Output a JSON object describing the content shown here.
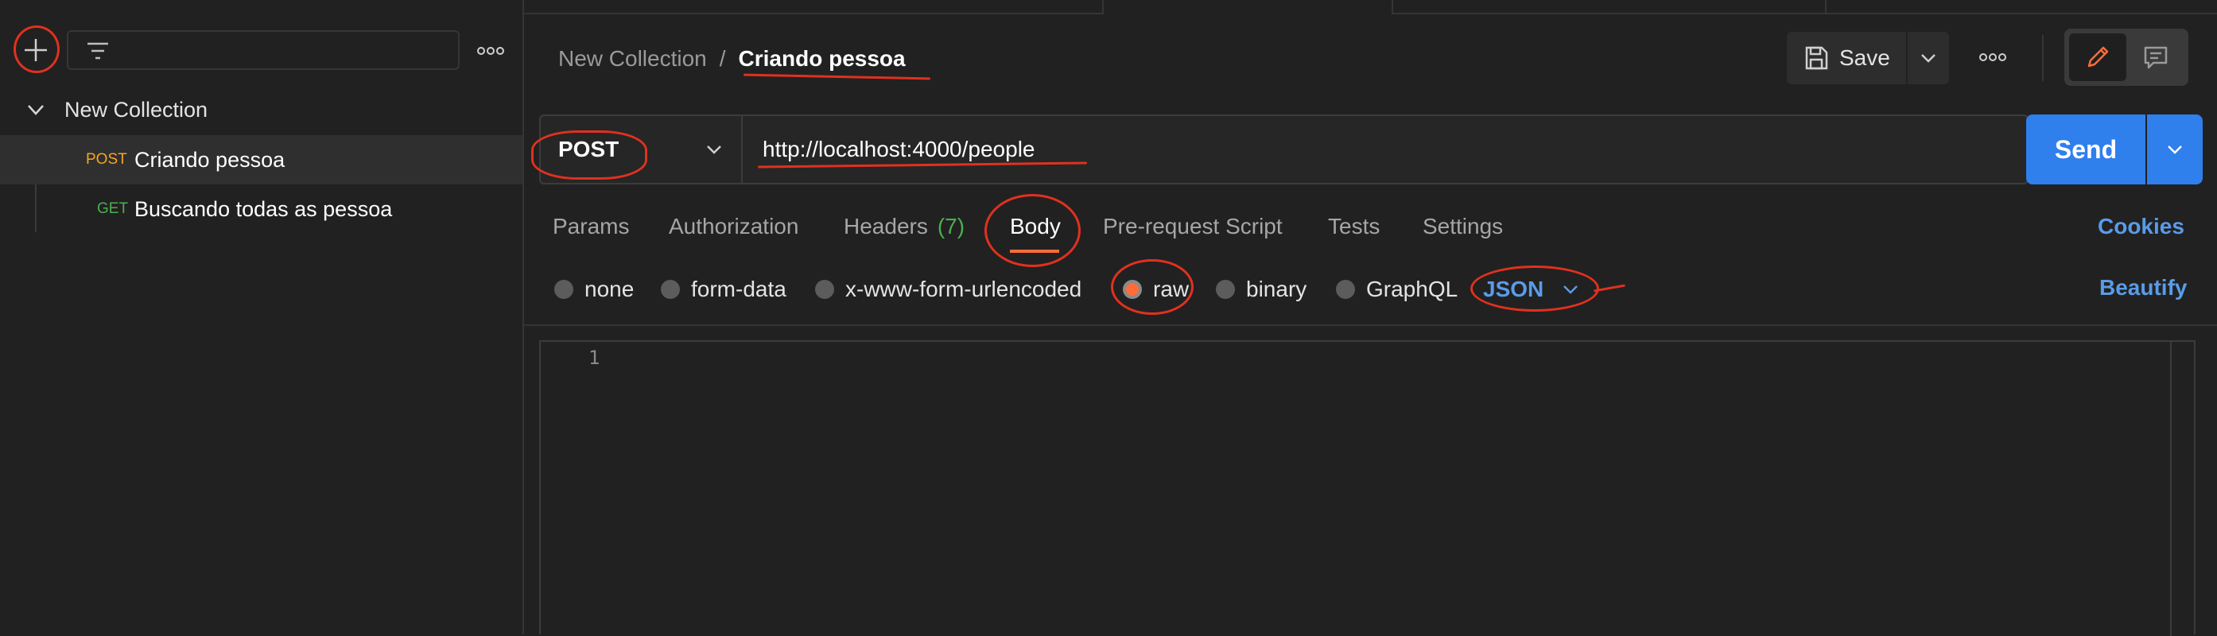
{
  "sidebar": {
    "search_placeholder": "",
    "collection_name": "New Collection",
    "requests": [
      {
        "method": "POST",
        "name": "Criando pessoa",
        "method_color": "#f5a623"
      },
      {
        "method": "GET",
        "name": "Buscando todas as pessoa",
        "method_color": "#4caf50"
      }
    ]
  },
  "header": {
    "breadcrumb_parent": "New Collection",
    "breadcrumb_sep": "/",
    "breadcrumb_current": "Criando pessoa",
    "save_label": "Save"
  },
  "request": {
    "method": "POST",
    "url": "http://localhost:4000/people",
    "send_label": "Send"
  },
  "tabs": {
    "params": "Params",
    "authorization": "Authorization",
    "headers": "Headers",
    "headers_count": "(7)",
    "body": "Body",
    "prerequest": "Pre-request Script",
    "tests": "Tests",
    "settings": "Settings",
    "cookies": "Cookies"
  },
  "body_options": {
    "none": "none",
    "form_data": "form-data",
    "urlencoded": "x-www-form-urlencoded",
    "raw": "raw",
    "binary": "binary",
    "graphql": "GraphQL",
    "format": "JSON",
    "beautify": "Beautify",
    "selected": "raw"
  },
  "editor": {
    "line_number": "1"
  },
  "colors": {
    "accent_blue": "#2f7fed",
    "link_blue": "#5a9be8",
    "annotation_red": "#e0311f",
    "method_post": "#f5a623"
  }
}
